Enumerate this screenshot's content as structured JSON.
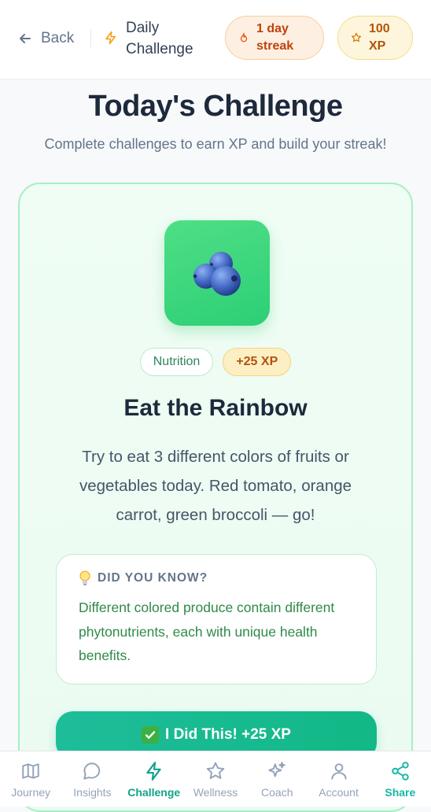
{
  "header": {
    "back_label": "Back",
    "title": "Daily Challenge",
    "streak_label": "1 day streak",
    "xp_label": "100 XP"
  },
  "page": {
    "title": "Today's Challenge",
    "subtitle": "Complete challenges to earn XP and build your streak!"
  },
  "challenge": {
    "emoji": "blueberries",
    "category": "Nutrition",
    "xp_badge": "+25 XP",
    "title": "Eat the Rainbow",
    "description": "Try to eat 3 different colors of fruits or vegetables today. Red tomato, orange carrot, green broccoli — go!",
    "fact_heading": "DID YOU KNOW?",
    "fact_text": "Different colored produce contain different phytonutrients, each with unique health benefits.",
    "complete_button": "I Did This! +25 XP"
  },
  "nav": {
    "items": [
      {
        "label": "Journey",
        "icon": "map-icon"
      },
      {
        "label": "Insights",
        "icon": "chat-bubble-icon"
      },
      {
        "label": "Challenge",
        "icon": "lightning-icon"
      },
      {
        "label": "Wellness",
        "icon": "star-icon"
      },
      {
        "label": "Coach",
        "icon": "sparkles-icon"
      },
      {
        "label": "Account",
        "icon": "user-icon"
      },
      {
        "label": "Share",
        "icon": "share-icon"
      }
    ],
    "active": "Challenge"
  },
  "colors": {
    "accent": "#12b886",
    "card_border": "#a7efc3",
    "streak": "#c2410c",
    "xp": "#b45309",
    "fact_text": "#2f8a48"
  }
}
